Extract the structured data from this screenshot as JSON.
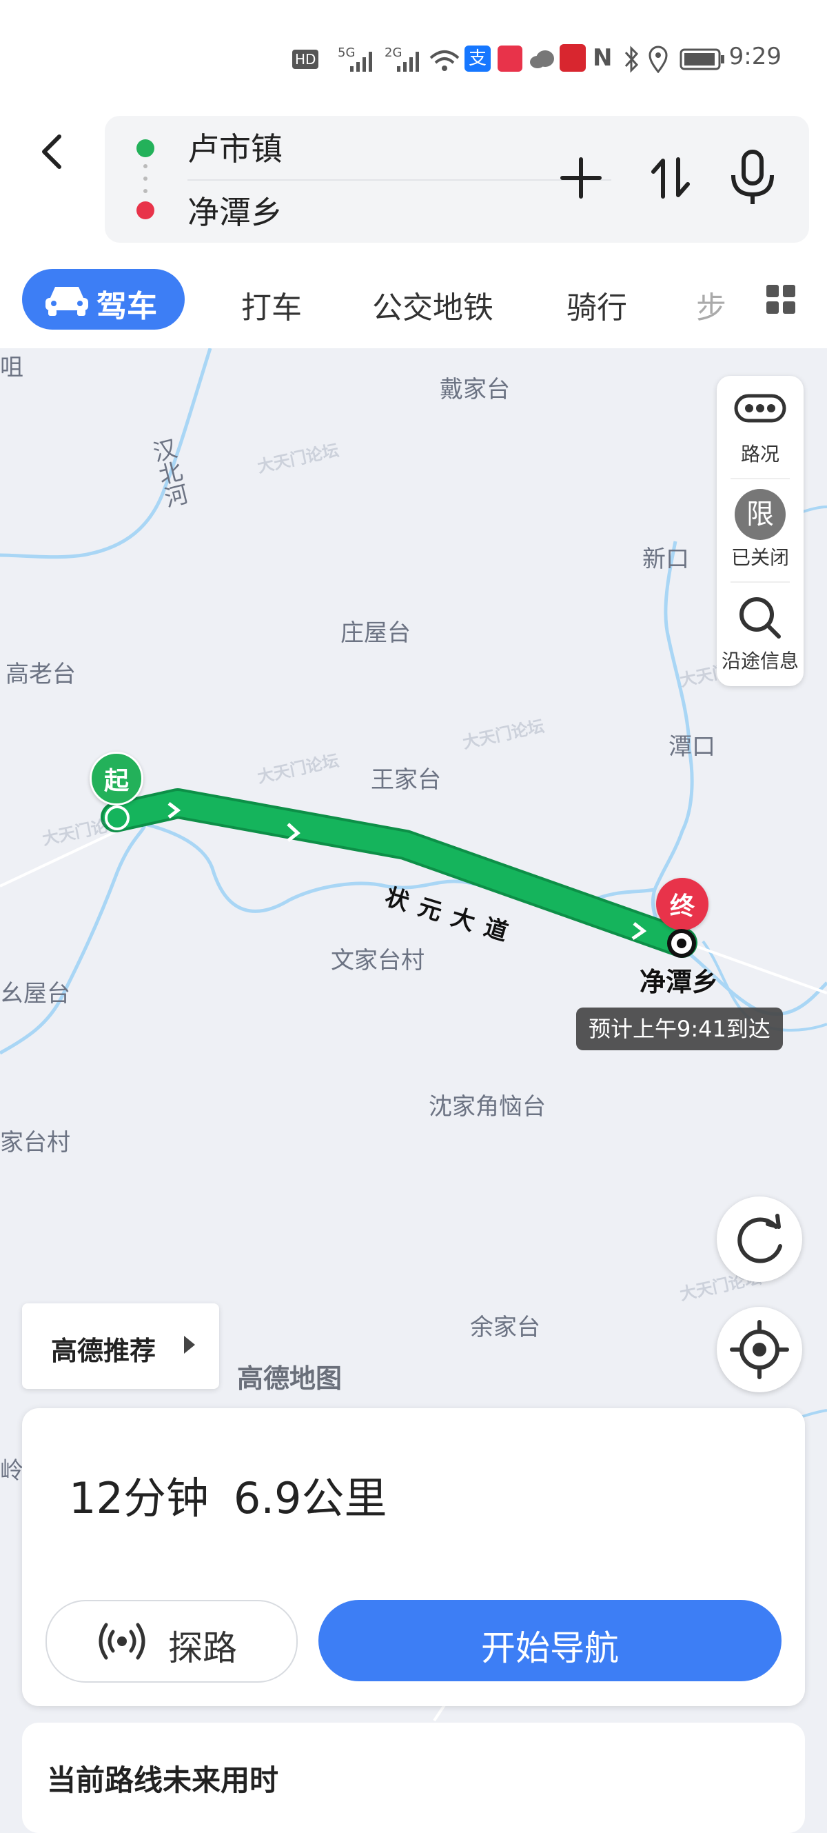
{
  "status_bar": {
    "network_badge": "HD",
    "signal_1": "5G",
    "signal_2": "2G",
    "time": "9:29"
  },
  "route": {
    "origin": "卢市镇",
    "destination": "净潭乡"
  },
  "tabs": {
    "drive": "驾车",
    "taxi": "打车",
    "transit": "公交地铁",
    "bike": "骑行",
    "walk": "步"
  },
  "map": {
    "labels": {
      "daijiatai": "戴家台",
      "hanbeihe": "汉北河",
      "xinkou": "新口",
      "zhuangwutai": "庄屋台",
      "gaolaotai": "高老台",
      "tankou": "潭口",
      "wangjiatai": "王家台",
      "wenjiataicun": "文家台村",
      "yaowutai": "幺屋台",
      "shenjiajiaonaotai": "沈家角恼台",
      "jiataicun": "家台村",
      "yujiatai": "余家台",
      "ling": "岭",
      "zu": "咀"
    },
    "road_name": "状元大道",
    "start_marker": "起",
    "end_marker": "终",
    "destination_label": "净潭乡",
    "eta_tooltip": "预计上午9:41到达",
    "watermark": "大天门论坛",
    "logo": "高德地图"
  },
  "tools": {
    "traffic": "路况",
    "restriction_icon": "限",
    "restriction": "已关闭",
    "along_info": "沿途信息"
  },
  "recommend": "高德推荐",
  "summary": {
    "duration": "12分钟",
    "distance": "6.9公里"
  },
  "buttons": {
    "probe": "探路",
    "start_nav": "开始导航"
  },
  "future_title": "当前路线未来用时",
  "colors": {
    "accent": "#3d7ef5",
    "route": "#15b45c",
    "start": "#23b15a",
    "end": "#e8334a",
    "water": "#a9d6f5"
  }
}
